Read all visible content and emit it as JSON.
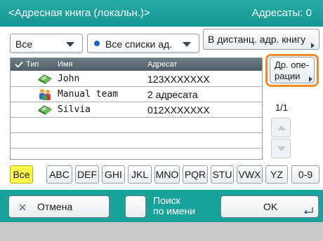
{
  "header": {
    "title": "<Адресная книга (локальн.)>",
    "count": "Адресаты: 0"
  },
  "filter": {
    "type_value": "Все",
    "list_value": "Все списки ад.",
    "remote_button": "В дистанц. адр. книгу"
  },
  "columns": {
    "type": "Тип",
    "name": "Имя",
    "address": "Адресат"
  },
  "rows": [
    {
      "icon": "contact-card-icon",
      "name": "John",
      "address": "123XXXXXXX"
    },
    {
      "icon": "group-people-icon",
      "name": "Manual team",
      "address": "2 адресата"
    },
    {
      "icon": "contact-card-icon",
      "name": "Silvia",
      "address": "012XXXXXXX"
    }
  ],
  "side": {
    "ops_line1": "Др. опе-",
    "ops_line2": "рации",
    "page": "1/1"
  },
  "alphabet": [
    "Все",
    "ABC",
    "DEF",
    "GHI",
    "JKL",
    "MNO",
    "PQR",
    "STU",
    "VWX",
    "YZ",
    "0-9"
  ],
  "bottom": {
    "cancel": "Отмена",
    "search_line1": "Поиск",
    "search_line2": "по имени",
    "ok": "OK"
  },
  "colors": {
    "header_bg": "#139795",
    "bottom_bar_bg": "#17a399",
    "selected_key": "#fff64a",
    "highlight_outline": "#f2892e"
  }
}
